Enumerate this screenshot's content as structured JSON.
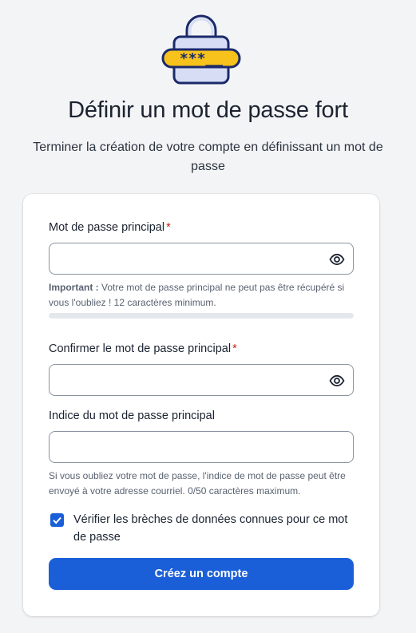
{
  "header": {
    "lock_stars": "***__",
    "title": "Définir un mot de passe fort",
    "subtitle": "Terminer la création de votre compte en définissant un mot de passe"
  },
  "form": {
    "master_password": {
      "label": "Mot de passe principal",
      "required_mark": "*",
      "value": "",
      "hint_bold": "Important :",
      "hint_text": " Votre mot de passe principal ne peut pas être récupéré si vous l'oubliez ! 12 caractères minimum.",
      "strength_percent": 0
    },
    "confirm_password": {
      "label": "Confirmer le mot de passe principal",
      "required_mark": "*",
      "value": ""
    },
    "password_hint": {
      "label": "Indice du mot de passe principal",
      "value": "",
      "help": "Si vous oubliez votre mot de passe, l'indice de mot de passe peut être envoyé à votre adresse courriel. 0/50 caractères maximum."
    },
    "breach_check": {
      "label": "Vérifier les brèches de données connues pour ce mot de passe",
      "checked": true
    },
    "submit_label": "Créez un compte"
  },
  "colors": {
    "accent": "#1a5fd8",
    "required": "#c2261b",
    "lock_body": "#d6ddf5",
    "lock_outline": "#1b2a6b",
    "lock_band": "#f6c21b"
  }
}
